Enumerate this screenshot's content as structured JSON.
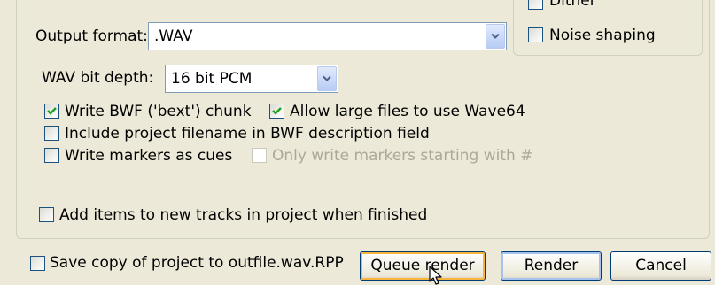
{
  "output_format": {
    "label": "Output format:",
    "value": ".WAV"
  },
  "dither": {
    "dither_label": "Dither",
    "noise_shaping_label": "Noise shaping",
    "noise_shaping_checked": false
  },
  "wav": {
    "bit_depth_label": "WAV bit depth:",
    "bit_depth_value": "16 bit PCM",
    "write_bwf_label": "Write BWF ('bext') chunk",
    "write_bwf_checked": true,
    "large_files_label": "Allow large files to use Wave64",
    "large_files_checked": true,
    "include_filename_label": "Include project filename in BWF description field",
    "include_filename_checked": false,
    "write_markers_label": "Write markers as cues",
    "write_markers_checked": false,
    "only_hash_label": "Only write markers starting with #",
    "only_hash_checked": false,
    "only_hash_enabled": false
  },
  "add_items": {
    "label": "Add items to new tracks in project when finished",
    "checked": false
  },
  "footer": {
    "save_copy_label": "Save copy of project to outfile.wav.RPP",
    "save_copy_checked": false,
    "queue_render_label": "Queue render",
    "render_label": "Render",
    "cancel_label": "Cancel"
  },
  "icons": {
    "checkmark": "checkmark-icon",
    "dropdown": "chevron-down-icon",
    "cursor": "mouse-pointer-icon"
  },
  "colors": {
    "face": "#ece9d8",
    "checkmark": "#21a121",
    "field_border": "#7f9db9",
    "button_border": "#003c74",
    "focus": "#f8b33d"
  }
}
